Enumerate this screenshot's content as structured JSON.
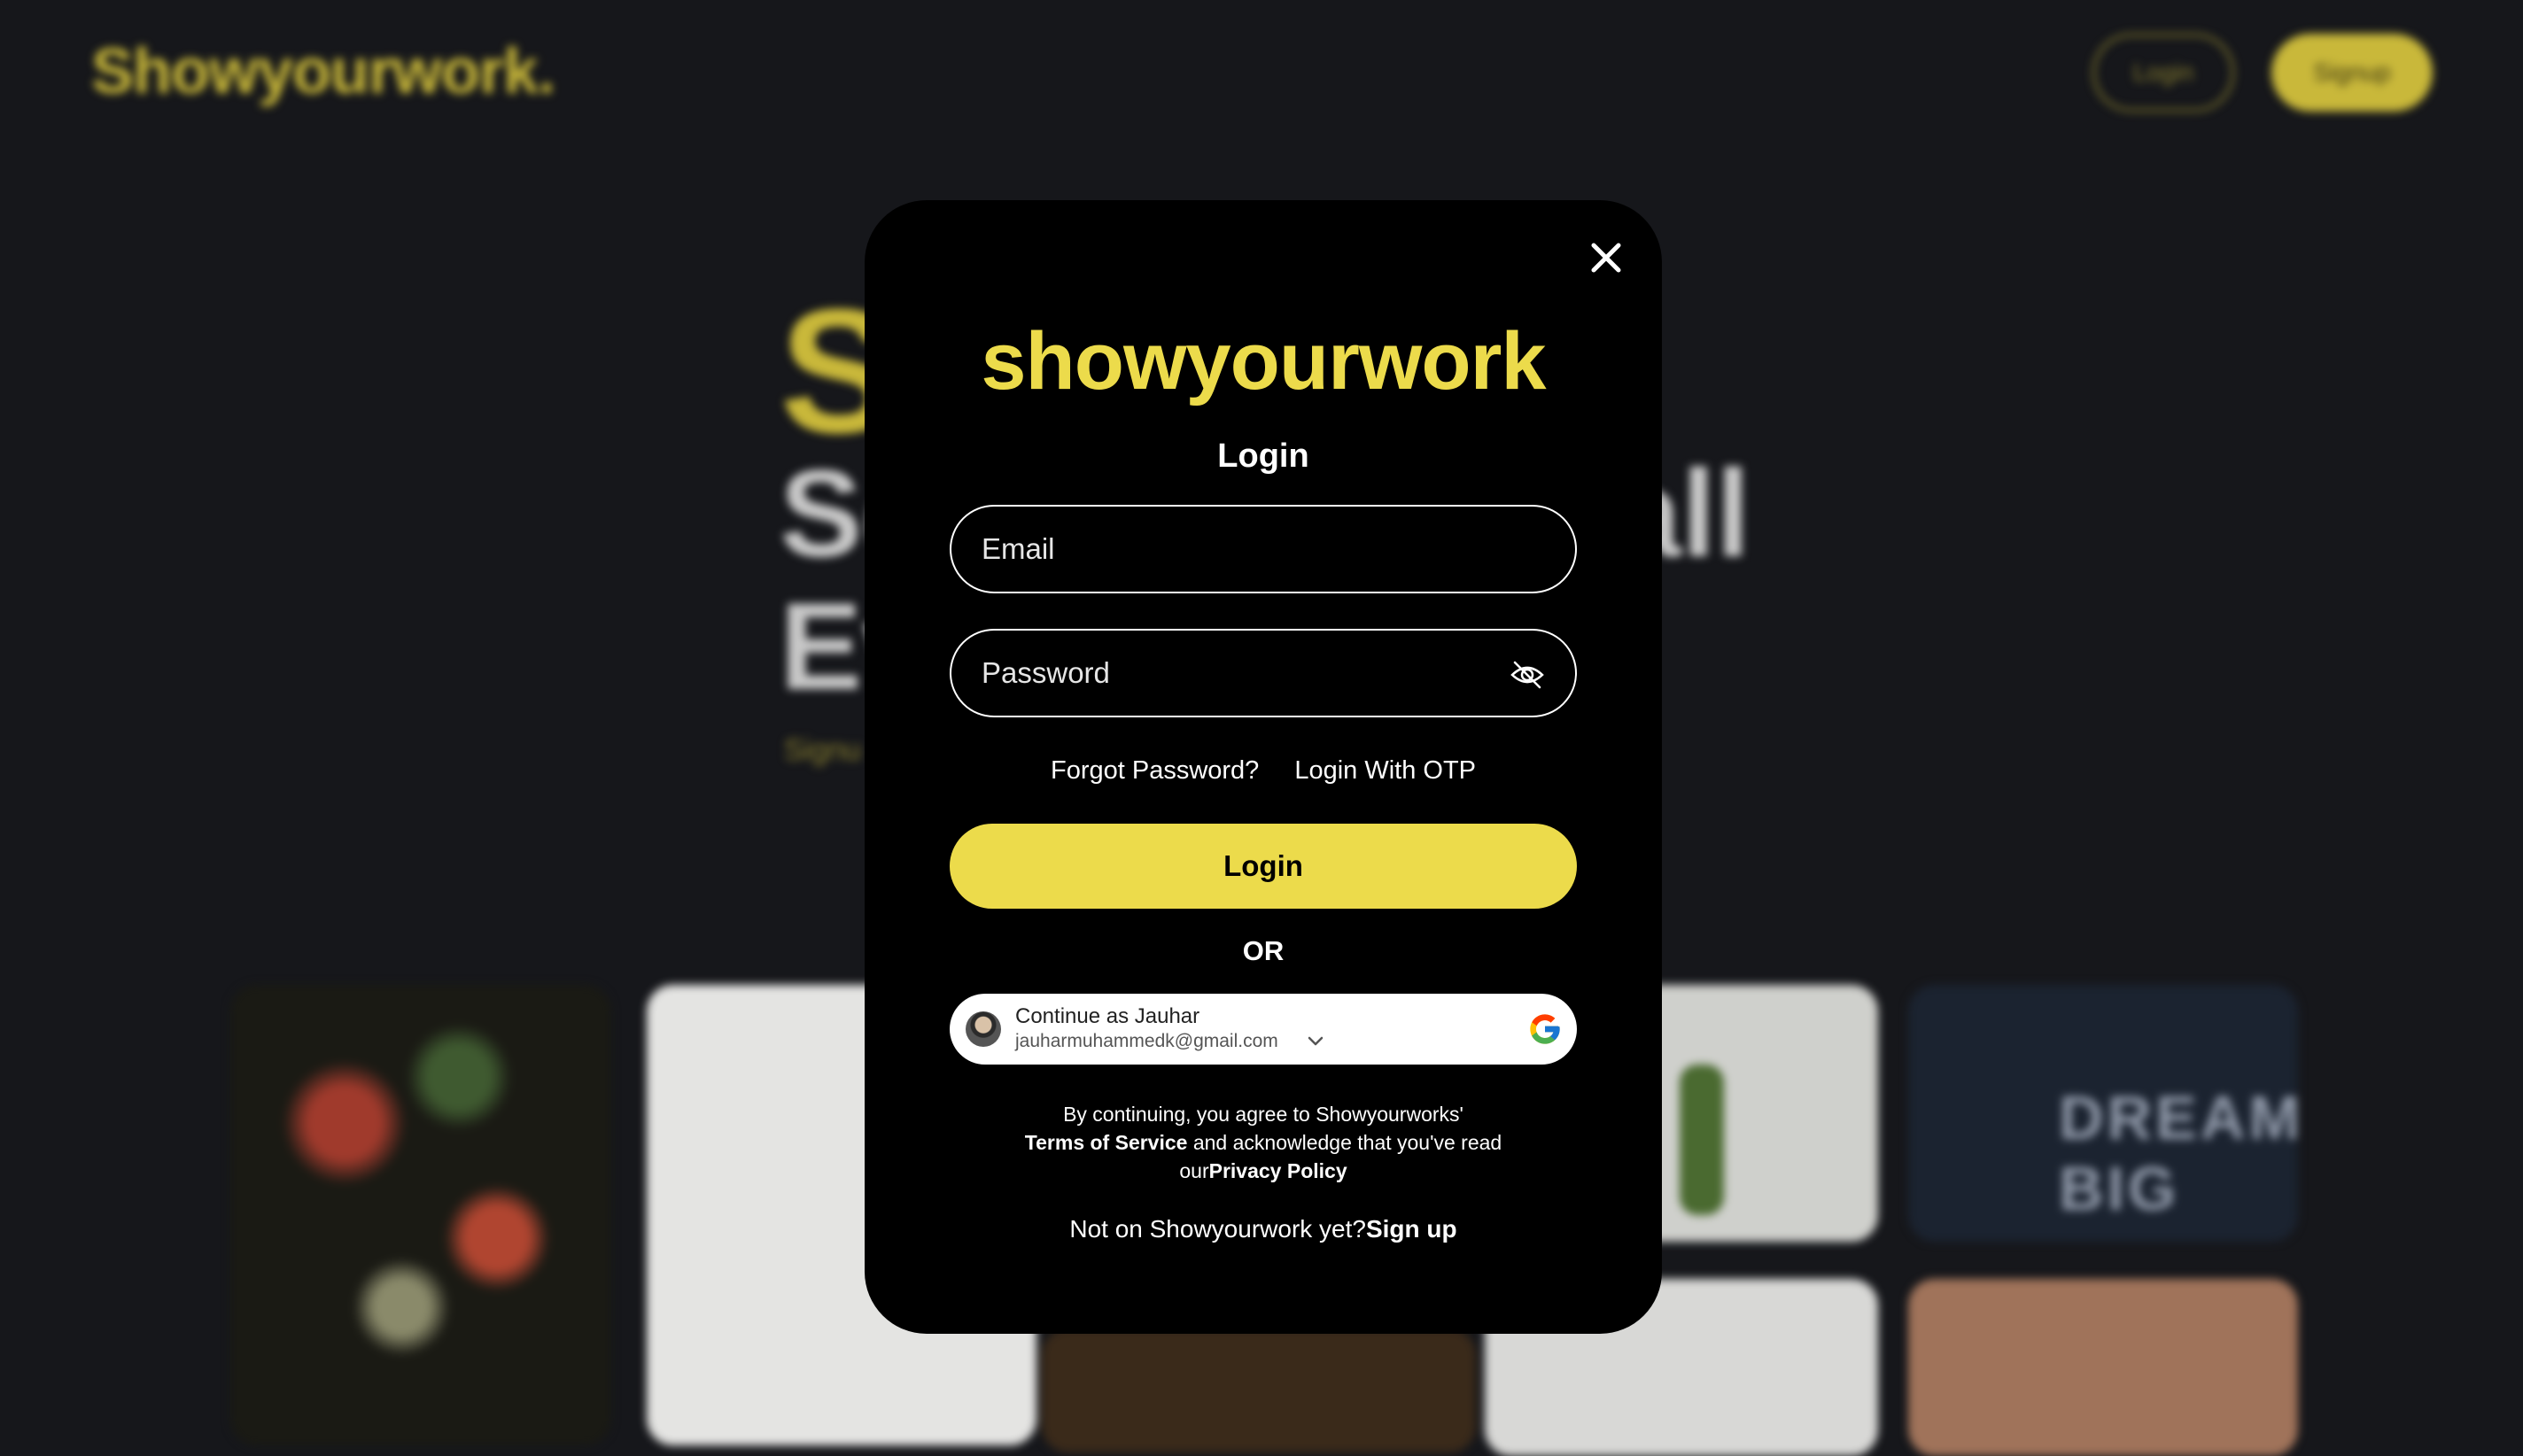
{
  "background": {
    "logo": "Showyourwork.",
    "login_label": "Login",
    "signup_label": "Signup",
    "hero_first": "S",
    "hero_line1": "Sc",
    "hero_line1_end": "all",
    "hero_line2": "Ev",
    "hero_sub": "Signu",
    "tile_text": "DREAM BIG"
  },
  "modal": {
    "brand": "showyourwork",
    "title": "Login",
    "email_placeholder": "Email",
    "password_placeholder": "Password",
    "forgot_password": "Forgot Password?",
    "login_otp": "Login With OTP",
    "login_button": "Login",
    "or": "OR",
    "google": {
      "name": "Continue as Jauhar",
      "email": "jauharmuhammedk@gmail.com"
    },
    "terms": {
      "line1": "By continuing, you agree to Showyourworks'",
      "terms_link": "Terms of Service",
      "line2_rest": " and acknowledge that you've read",
      "line3_prefix": "our",
      "privacy_link": "Privacy Policy"
    },
    "signup": {
      "prompt": "Not on Showyourwork yet?",
      "link": "Sign up"
    }
  },
  "colors": {
    "accent": "#ecdb4b",
    "modal_bg": "#000000",
    "page_bg": "#16171b"
  }
}
